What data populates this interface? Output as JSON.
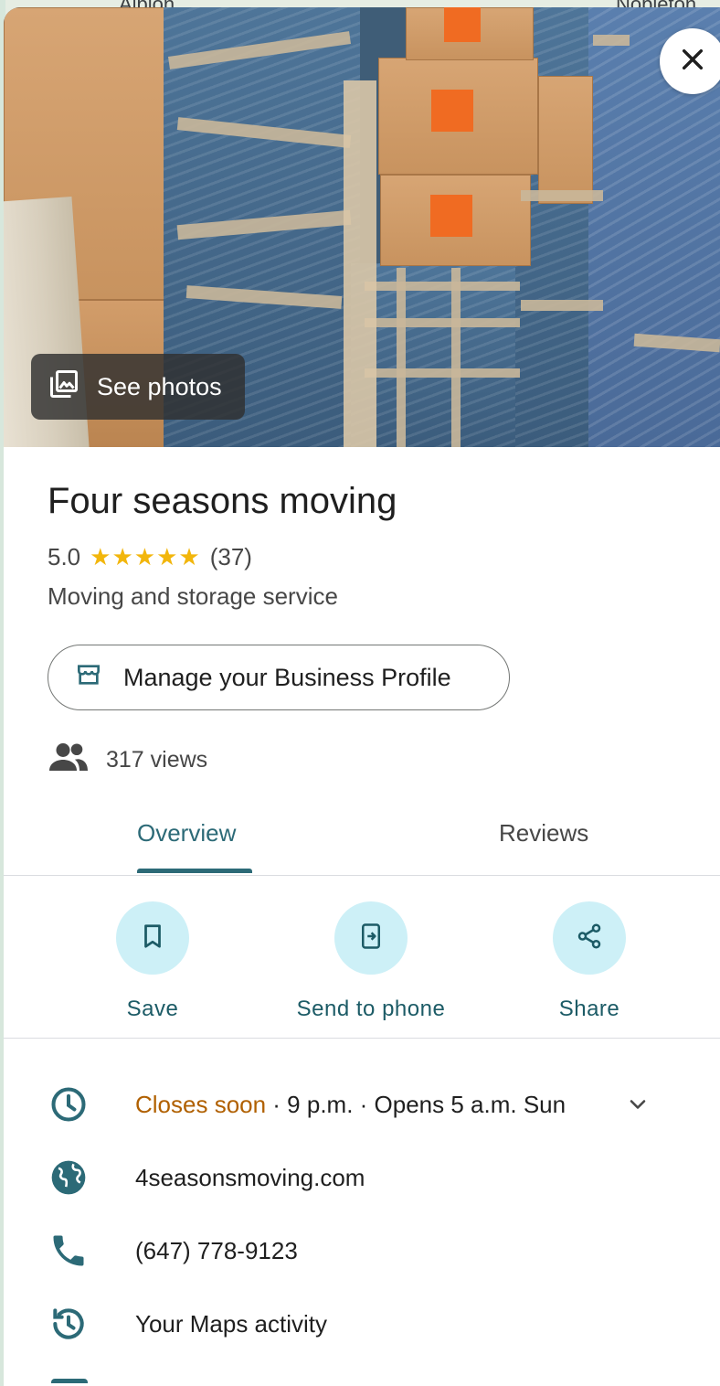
{
  "map": {
    "label_left": "Albion",
    "label_right": "Nobleton"
  },
  "hero": {
    "see_photos_label": "See photos",
    "photo_icon": "photo-library-icon",
    "close_icon": "close-icon"
  },
  "place": {
    "name": "Four seasons moving",
    "rating": "5.0",
    "stars": "★★★★★",
    "review_count": "(37)",
    "category": "Moving and storage service"
  },
  "manage_button": {
    "label": "Manage your Business Profile",
    "icon": "storefront-icon"
  },
  "views": {
    "text": "317 views",
    "icon": "people-icon"
  },
  "tabs": [
    {
      "label": "Overview",
      "active": true
    },
    {
      "label": "Reviews",
      "active": false
    }
  ],
  "actions": [
    {
      "label": "Save",
      "icon": "bookmark-icon"
    },
    {
      "label": "Send to phone",
      "icon": "send-to-phone-icon"
    },
    {
      "label": "Share",
      "icon": "share-icon"
    }
  ],
  "info": {
    "hours": {
      "status": "Closes soon",
      "detail": " · 9 p.m. · Opens 5 a.m. Sun",
      "icon": "clock-icon"
    },
    "website": {
      "text": "4seasonsmoving.com",
      "icon": "globe-icon"
    },
    "phone": {
      "text": "(647) 778-9123",
      "icon": "phone-icon"
    },
    "activity": {
      "text": "Your Maps activity",
      "icon": "history-icon"
    }
  },
  "colors": {
    "accent": "#2c6a77",
    "action_circle": "#cdf0f7",
    "closes_soon": "#b06000",
    "star": "#f2b60c"
  }
}
